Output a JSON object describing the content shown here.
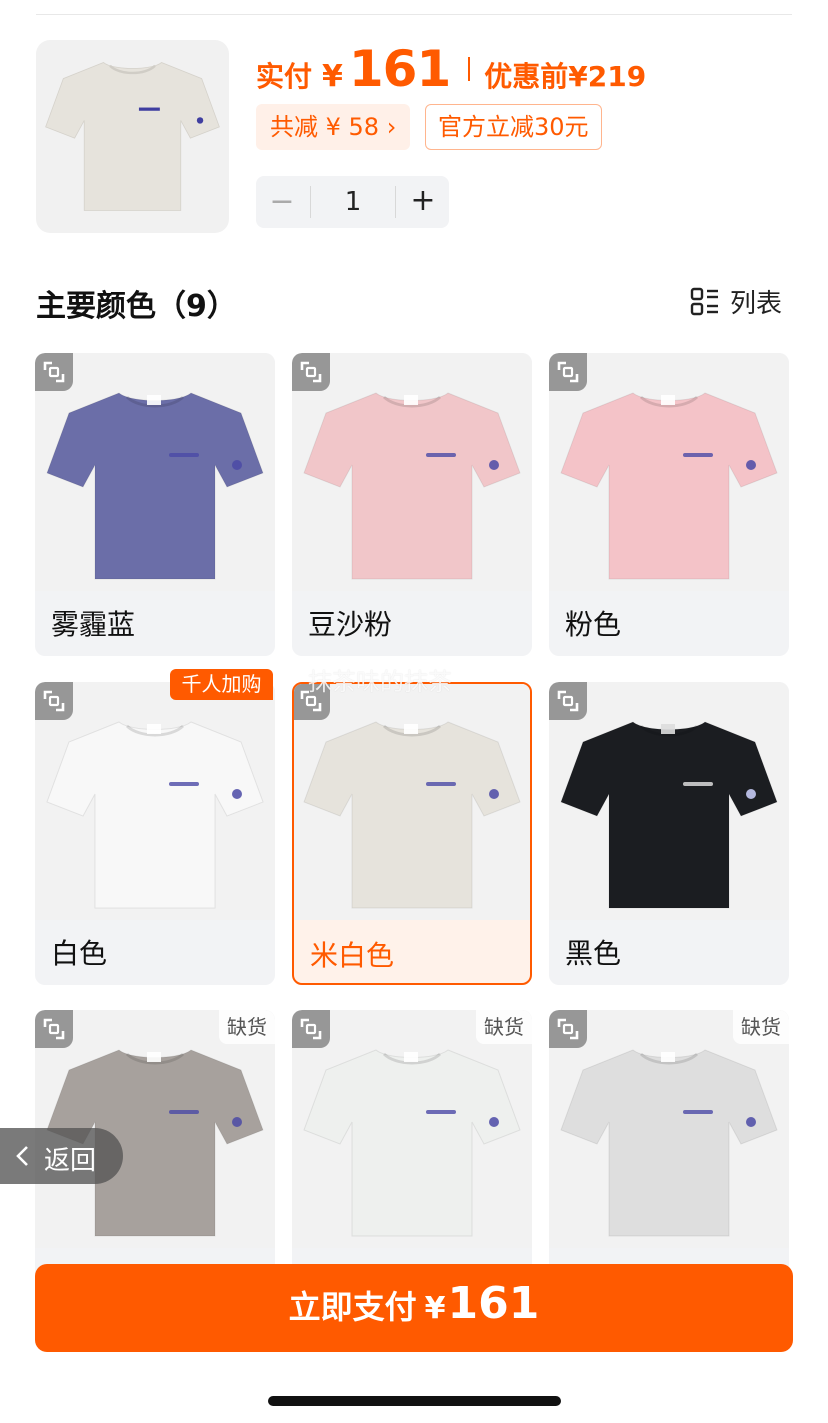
{
  "summary": {
    "actual_label": "实付",
    "currency": "¥",
    "actual_price": "161",
    "before_label": "优惠前",
    "before_price": "¥219",
    "reduce_chip": "共减 ¥ 58 ›",
    "official_chip": "官方立减30元",
    "quantity": "1",
    "minus": "−",
    "plus": "+",
    "thumb_color": "#e6e3dc"
  },
  "section": {
    "title": "主要颜色（9）",
    "view_label": "列表"
  },
  "colors": [
    {
      "name": "雾霾蓝",
      "shirt": "#6b6ea8"
    },
    {
      "name": "豆沙粉",
      "shirt": "#f1c6c9"
    },
    {
      "name": "粉色",
      "shirt": "#f4c3c8"
    },
    {
      "name": "白色",
      "shirt": "#f8f8f8",
      "badge": "千人加购"
    },
    {
      "name": "米白色",
      "shirt": "#e6e3dc",
      "selected": true
    },
    {
      "name": "黑色",
      "shirt": "#1b1d21"
    },
    {
      "name": "",
      "shirt": "#a7a19d",
      "status": "缺货"
    },
    {
      "name": "",
      "shirt": "#eef0ee",
      "status": "缺货"
    },
    {
      "name": "",
      "shirt": "#dedede",
      "status": "缺货"
    }
  ],
  "watermark": "抹茶味的抹茶",
  "back_label": "返回",
  "pay": {
    "label": "立即支付",
    "currency": "¥",
    "amount": "161"
  },
  "accent_color": "#ff5a00"
}
